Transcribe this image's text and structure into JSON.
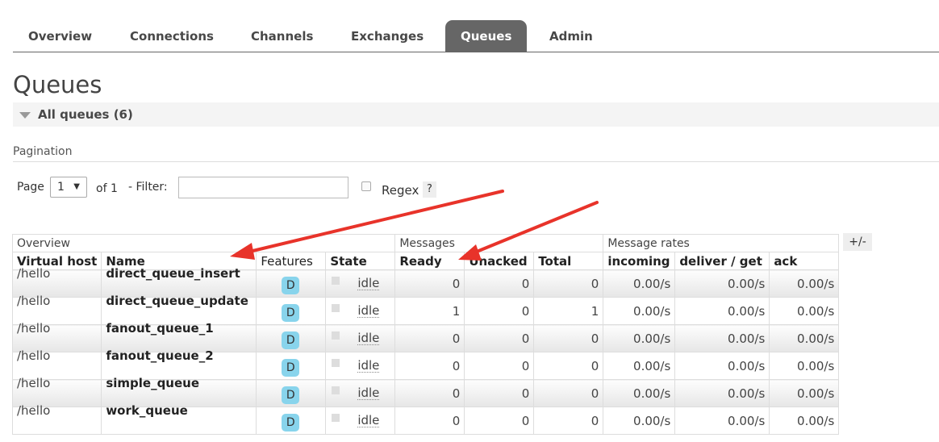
{
  "tabs": [
    {
      "label": "Overview",
      "active": false
    },
    {
      "label": "Connections",
      "active": false
    },
    {
      "label": "Channels",
      "active": false
    },
    {
      "label": "Exchanges",
      "active": false
    },
    {
      "label": "Queues",
      "active": true
    },
    {
      "label": "Admin",
      "active": false
    }
  ],
  "page_title": "Queues",
  "section": {
    "label": "All queues (6)"
  },
  "pagination": {
    "heading": "Pagination",
    "page_label": "Page",
    "page_value": "1",
    "of_label": "of 1",
    "filter_label": "- Filter:",
    "filter_value": "",
    "regex_label": "Regex",
    "help_label": "?"
  },
  "table": {
    "groups": [
      "Overview",
      "Messages",
      "Message rates"
    ],
    "columns": [
      "Virtual host",
      "Name",
      "Features",
      "State",
      "Ready",
      "Unacked",
      "Total",
      "incoming",
      "deliver / get",
      "ack"
    ],
    "rows": [
      {
        "vhost": "/hello",
        "name": "direct_queue_insert",
        "feature": "D",
        "state": "idle",
        "ready": "0",
        "unacked": "0",
        "total": "0",
        "incoming": "0.00/s",
        "deliver": "0.00/s",
        "ack": "0.00/s"
      },
      {
        "vhost": "/hello",
        "name": "direct_queue_update",
        "feature": "D",
        "state": "idle",
        "ready": "1",
        "unacked": "0",
        "total": "1",
        "incoming": "0.00/s",
        "deliver": "0.00/s",
        "ack": "0.00/s"
      },
      {
        "vhost": "/hello",
        "name": "fanout_queue_1",
        "feature": "D",
        "state": "idle",
        "ready": "0",
        "unacked": "0",
        "total": "0",
        "incoming": "0.00/s",
        "deliver": "0.00/s",
        "ack": "0.00/s"
      },
      {
        "vhost": "/hello",
        "name": "fanout_queue_2",
        "feature": "D",
        "state": "idle",
        "ready": "0",
        "unacked": "0",
        "total": "0",
        "incoming": "0.00/s",
        "deliver": "0.00/s",
        "ack": "0.00/s"
      },
      {
        "vhost": "/hello",
        "name": "simple_queue",
        "feature": "D",
        "state": "idle",
        "ready": "0",
        "unacked": "0",
        "total": "0",
        "incoming": "0.00/s",
        "deliver": "0.00/s",
        "ack": "0.00/s"
      },
      {
        "vhost": "/hello",
        "name": "work_queue",
        "feature": "D",
        "state": "idle",
        "ready": "0",
        "unacked": "0",
        "total": "0",
        "incoming": "0.00/s",
        "deliver": "0.00/s",
        "ack": "0.00/s"
      }
    ],
    "toggle_label": "+/-"
  },
  "colors": {
    "active_tab": "#666666",
    "feature_badge": "#88d4ec",
    "annotation_arrow": "#e8332a"
  }
}
